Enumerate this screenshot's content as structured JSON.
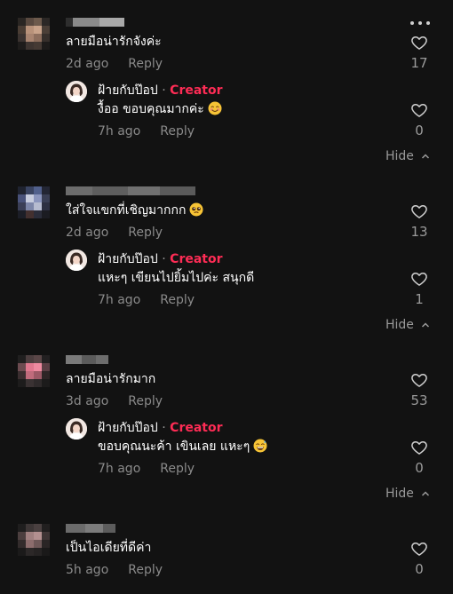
{
  "comments": [
    {
      "text": "ลายมือน่ารักจังค่ะ",
      "time": "2d ago",
      "reply_label": "Reply",
      "likes": "17",
      "reply": {
        "author": "ฝ้ายกับป๊อป",
        "badge": "Creator",
        "text": "งื้ออ ขอบคุณมากค่ะ",
        "emoji": "smiling-face-icon",
        "time": "7h ago",
        "reply_label": "Reply",
        "likes": "0"
      },
      "hide_label": "Hide"
    },
    {
      "text": "ใส่ใจแขกที่เชิญมากกก",
      "emoji": "pleading-face-icon",
      "time": "2d ago",
      "reply_label": "Reply",
      "likes": "13",
      "reply": {
        "author": "ฝ้ายกับป๊อป",
        "badge": "Creator",
        "text": "แหะๆ เขียนไปยิ้มไปค่ะ สนุกดี",
        "time": "7h ago",
        "reply_label": "Reply",
        "likes": "1"
      },
      "hide_label": "Hide"
    },
    {
      "text": "ลายมือน่ารักมาก",
      "time": "3d ago",
      "reply_label": "Reply",
      "likes": "53",
      "reply": {
        "author": "ฝ้ายกับป๊อป",
        "badge": "Creator",
        "text": "ขอบคุณนะค้า เขินเลย แหะๆ",
        "emoji": "sweat-smile-icon",
        "time": "7h ago",
        "reply_label": "Reply",
        "likes": "0"
      },
      "hide_label": "Hide"
    },
    {
      "text": "เป็นไอเดียที่ดีค่า",
      "time": "5h ago",
      "reply_label": "Reply",
      "likes": "0"
    }
  ],
  "colors": {
    "background": "#121212",
    "creator_badge": "#fe2c55",
    "secondary_text": "#8a8a8a"
  }
}
